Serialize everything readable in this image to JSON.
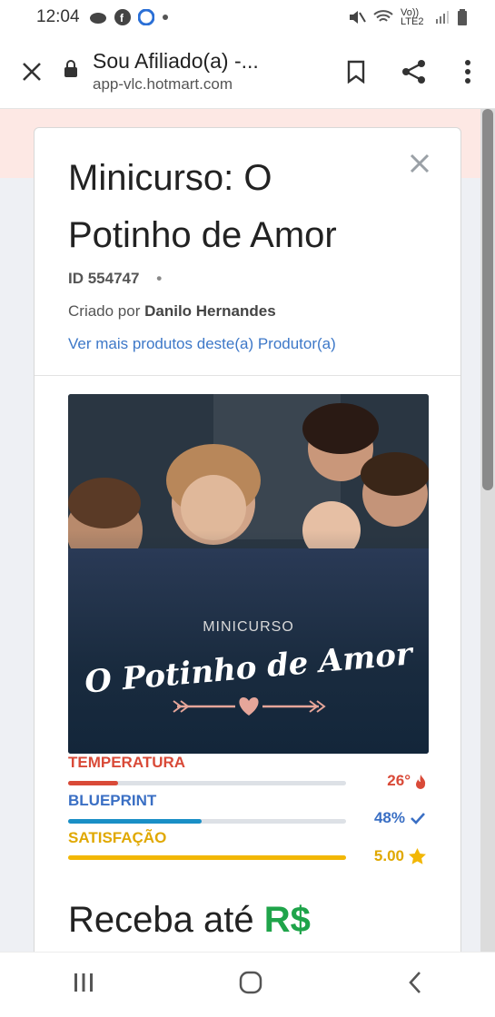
{
  "status": {
    "time": "12:04",
    "network": "Vo)) LTE2"
  },
  "browser": {
    "page_title": "Sou Afiliado(a) -...",
    "url": "app-vlc.hotmart.com"
  },
  "modal": {
    "title": "Minicurso: O Potinho de Amor",
    "id_text": "ID 554747",
    "separator": "•",
    "created_by_prefix": "Criado por",
    "author": "Danilo Hernandes",
    "more_products_link": "Ver mais produtos deste(a) Produtor(a)"
  },
  "product_image": {
    "overlay_small": "MINICURSO",
    "overlay_script": "O Potinho de Amor"
  },
  "metrics": [
    {
      "label": "TEMPERATURA",
      "value": "26°",
      "level": 0.18,
      "color": "#d94a38",
      "icon": "flame-icon"
    },
    {
      "label": "BLUEPRINT",
      "value": "48%",
      "level": 0.48,
      "color": "#1a8fc6",
      "icon": "check-icon"
    },
    {
      "label": "SATISFAÇÃO",
      "value": "5.00",
      "level": 1.0,
      "color": "#f2b705",
      "icon": "star-icon"
    }
  ],
  "receba": {
    "text": "Receba até",
    "currency": "R$"
  },
  "colors": {
    "link": "#3d78c8",
    "temperature": "#d94a38",
    "blueprint": "#3a6fc4",
    "satisfaction": "#e0a800",
    "currency": "#1fa44a"
  }
}
